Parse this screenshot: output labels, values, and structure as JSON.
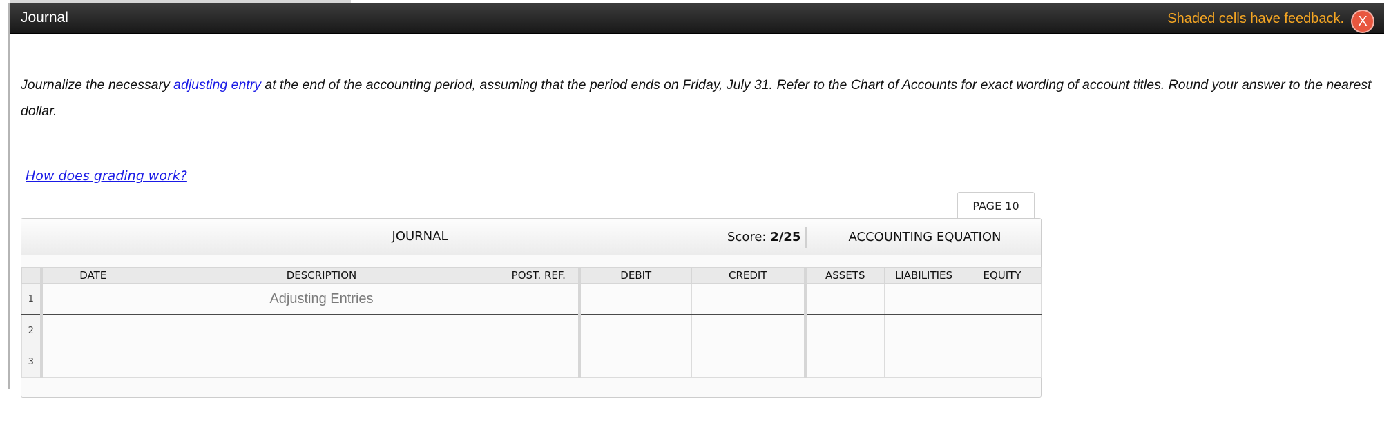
{
  "window": {
    "title": "Journal",
    "feedback_note": "Shaded cells have feedback.",
    "close_label": "X"
  },
  "instructions": {
    "before_link": "Journalize the necessary ",
    "link_text": "adjusting entry",
    "after_link": " at the end of the accounting period, assuming that the period ends on Friday, July 31. Refer to the Chart of Accounts for exact wording of account titles. Round your answer to the nearest dollar."
  },
  "grading_link": "How does grading work?",
  "page_tab": "PAGE 10",
  "journal": {
    "title": "JOURNAL",
    "score_label": "Score: ",
    "score_value": "2/25",
    "equation_title": "ACCOUNTING EQUATION",
    "columns": {
      "date": "DATE",
      "description": "DESCRIPTION",
      "post_ref": "POST. REF.",
      "debit": "DEBIT",
      "credit": "CREDIT",
      "assets": "ASSETS",
      "liabilities": "LIABILITIES",
      "equity": "EQUITY"
    },
    "rows": [
      {
        "num": "1",
        "description": "Adjusting Entries"
      },
      {
        "num": "2",
        "description": ""
      },
      {
        "num": "3",
        "description": ""
      }
    ]
  },
  "colors": {
    "titlebar": "#222222",
    "feedback": "#f5a623",
    "close": "#e8573f",
    "link": "#1a1ae6"
  }
}
